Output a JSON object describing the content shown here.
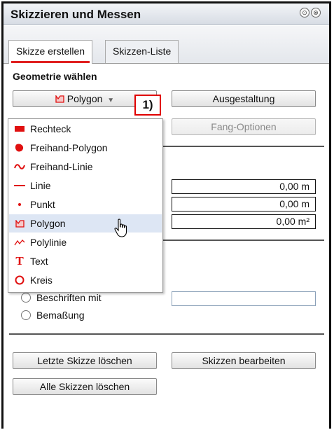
{
  "window": {
    "title": "Skizzieren und Messen",
    "buttons": [
      "⊙",
      "⊗"
    ]
  },
  "tabs": [
    {
      "label": "Skizze erstellen",
      "active": true
    },
    {
      "label": "Skizzen-Liste",
      "active": false
    }
  ],
  "geometry": {
    "heading": "Geometrie wählen",
    "selected": "Polygon",
    "callout": "1)"
  },
  "buttons": {
    "ausgestaltung": "Ausgestaltung",
    "fang_optionen": "Fang-Optionen",
    "letzte_loeschen": "Letzte Skizze löschen",
    "bearbeiten": "Skizzen bearbeiten",
    "alle_loeschen": "Alle Skizzen löschen"
  },
  "dropdown_items": [
    {
      "label": "Rechteck",
      "icon": "rectangle-icon"
    },
    {
      "label": "Freihand-Polygon",
      "icon": "freehand-polygon-icon"
    },
    {
      "label": "Freihand-Linie",
      "icon": "freehand-line-icon"
    },
    {
      "label": "Linie",
      "icon": "line-icon"
    },
    {
      "label": "Punkt",
      "icon": "point-icon"
    },
    {
      "label": "Polygon",
      "icon": "polygon-icon"
    },
    {
      "label": "Polylinie",
      "icon": "polyline-icon"
    },
    {
      "label": "Text",
      "icon": "text-icon"
    },
    {
      "label": "Kreis",
      "icon": "circle-icon"
    }
  ],
  "measurements": {
    "length": "0,00 m",
    "perimeter": "0,00 m",
    "area": "0,00 m²"
  },
  "options": {
    "beschriften": "Beschriften mit",
    "bemassung": "Bemaßung"
  },
  "colors": {
    "icon_red": "#e01010",
    "highlight": "#dde6f4",
    "accent_underline": "#e02020"
  }
}
